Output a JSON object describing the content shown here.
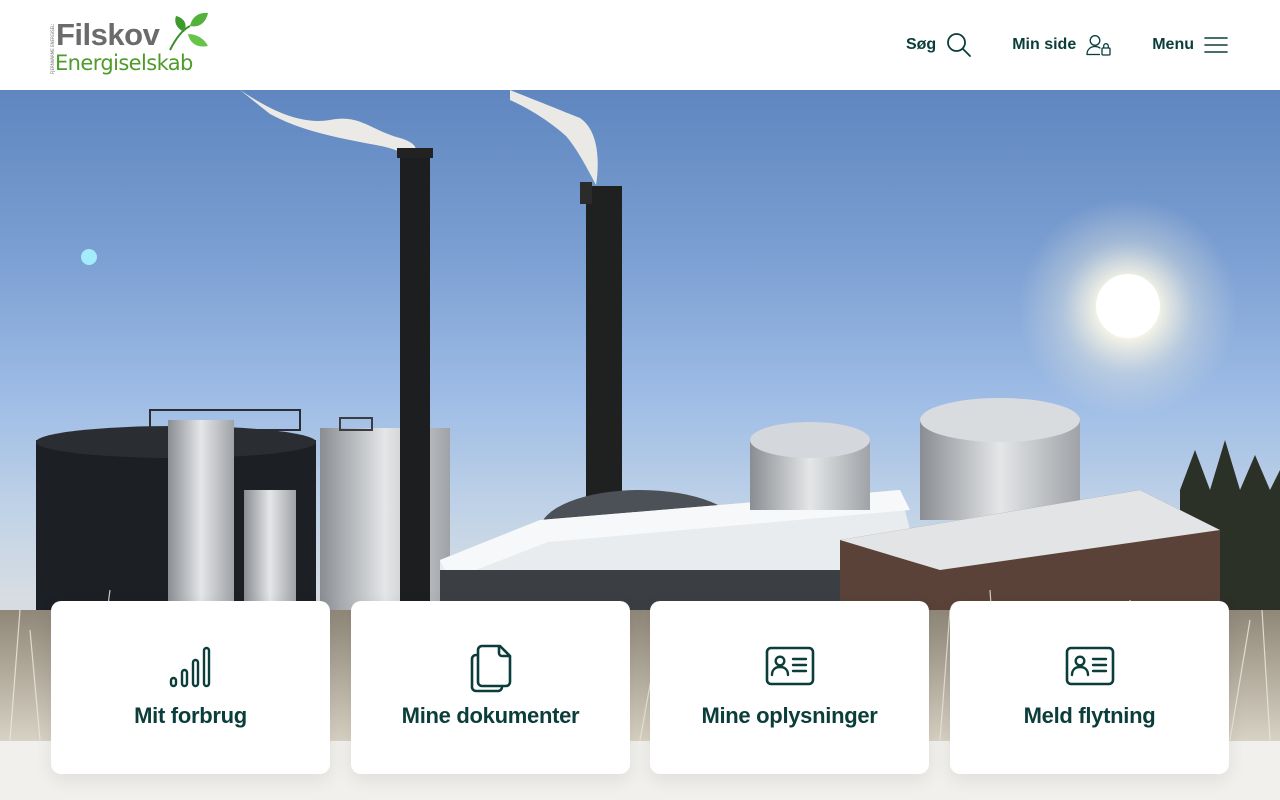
{
  "header": {
    "logo": {
      "brand": "Filskov",
      "sub": "Energiselskab",
      "tiny": "FJERNVARME ENERGISELSKAB"
    },
    "nav": [
      {
        "label": "Søg",
        "icon": "search-icon"
      },
      {
        "label": "Min side",
        "icon": "user-lock-icon"
      },
      {
        "label": "Menu",
        "icon": "hamburger-icon"
      }
    ]
  },
  "hero": {
    "image": "biogas-plant-winter-photo"
  },
  "cards": [
    {
      "label": "Mit forbrug",
      "icon": "signal-bars-icon"
    },
    {
      "label": "Mine dokumenter",
      "icon": "documents-icon"
    },
    {
      "label": "Mine oplysninger",
      "icon": "id-card-icon"
    },
    {
      "label": "Meld flytning",
      "icon": "id-card-icon"
    }
  ],
  "colors": {
    "primary": "#0b3d3a",
    "logo_gray": "#6b6b6b",
    "logo_green": "#4e9b2a",
    "page_bg": "#f1f0ec",
    "card_bg": "#ffffff"
  }
}
